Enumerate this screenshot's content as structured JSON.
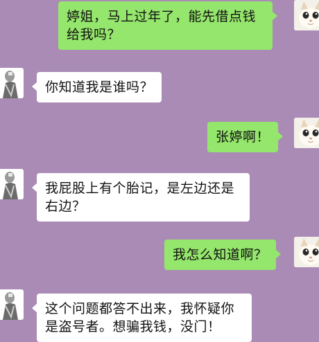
{
  "colors": {
    "background": "#a98bb5",
    "my_bubble": "#95e66c",
    "their_bubble": "#ffffff"
  },
  "messages": [
    {
      "from": "me",
      "text": "婷姐，马上过年了，能先借点钱给我吗？",
      "avatar": "cat-avatar-icon"
    },
    {
      "from": "other",
      "text": "你知道我是谁吗？",
      "avatar": "figurine-avatar-icon"
    },
    {
      "from": "me",
      "text": "张婷啊！",
      "avatar": "cat-avatar-icon"
    },
    {
      "from": "other",
      "text": "我屁股上有个胎记，是左边还是右边？",
      "avatar": "figurine-avatar-icon"
    },
    {
      "from": "me",
      "text": "我怎么知道啊？",
      "avatar": "cat-avatar-icon"
    },
    {
      "from": "other",
      "text": "这个问题都答不出来，我怀疑你是盗号者。想骗我钱，没门！",
      "avatar": "figurine-avatar-icon"
    }
  ]
}
